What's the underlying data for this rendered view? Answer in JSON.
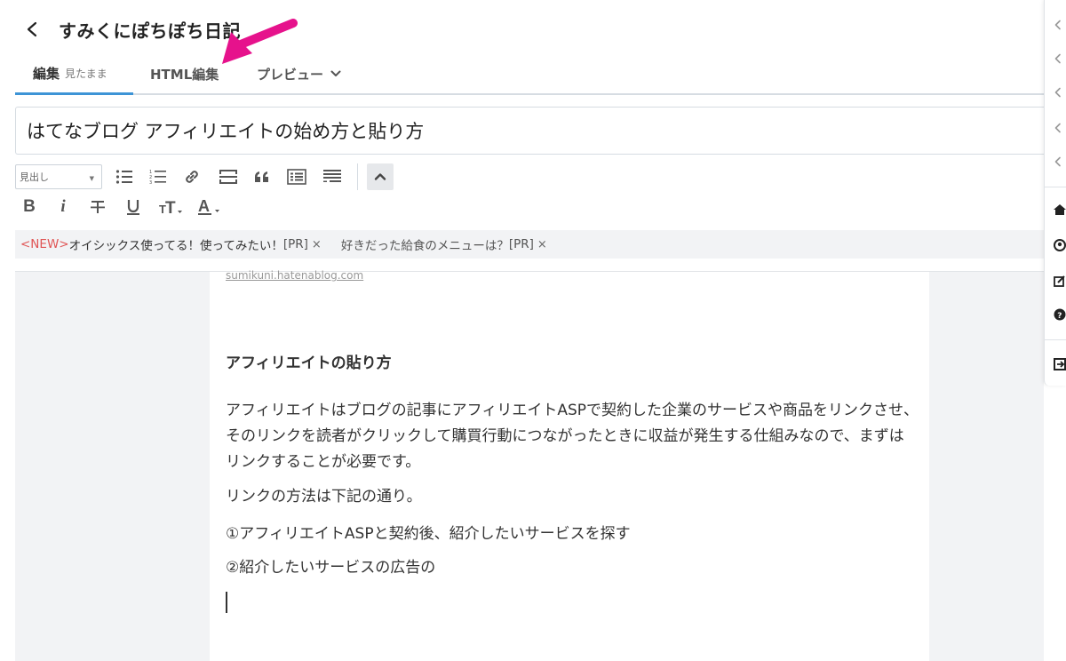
{
  "header": {
    "blog_title": "すみくにぽちぽち日記"
  },
  "tabs": {
    "edit_label": "編集",
    "edit_mode": "見たまま",
    "html_label": "HTML編集",
    "preview_label": "プレビュー"
  },
  "title_input": {
    "value": "はてなブログ アフィリエイトの始め方と貼り方"
  },
  "toolbar": {
    "heading_select": "見出し"
  },
  "topics": [
    {
      "new_tag": "<NEW>",
      "text": "オイシックス使ってる！使ってみたい！",
      "pr": "[PR]",
      "close": "×"
    },
    {
      "new_tag": "",
      "text": "好きだった給食のメニューは？",
      "pr": "[PR]",
      "close": "×"
    }
  ],
  "editor": {
    "source_link": "sumikuni.hatenablog.com",
    "heading": "アフィリエイトの貼り方",
    "paragraphs": [
      "アフィリエイトはブログの記事にアフィリエイトASPで契約した企業のサービスや商品をリンクさせ、そのリンクを読者がクリックして購買行動につながったときに収益が発生する仕組みなので、まずはリンクすることが必要です。",
      "リンクの方法は下記の通り。",
      "①アフィリエイトASPと契約後、紹介したいサービスを探す",
      "②紹介したいサービスの広告の"
    ]
  },
  "colors": {
    "tab_active": "#3d94d6",
    "annotation_arrow": "#e6128c",
    "new_tag": "#e05555",
    "editor_bg": "#f2f3f5"
  },
  "icons": {
    "side_panel": [
      "chevron-left-icon",
      "chevron-left-icon",
      "chevron-left-icon",
      "chevron-left-icon",
      "chevron-left-icon",
      "home-icon",
      "user-icon",
      "edit-icon",
      "help-icon",
      "exit-icon"
    ]
  }
}
